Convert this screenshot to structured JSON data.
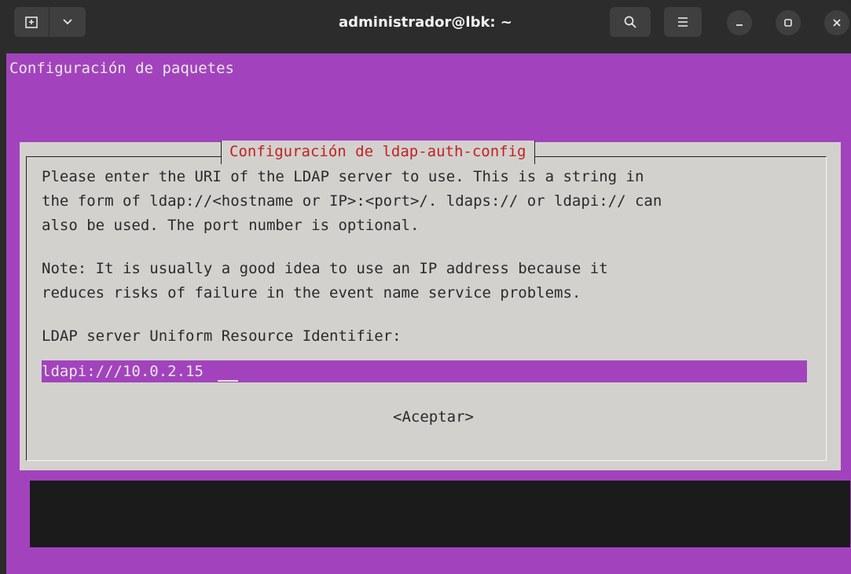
{
  "titlebar": {
    "title": "administrador@lbk: ~",
    "icons": [
      "new-tab-icon",
      "chevron-down-icon",
      "search-icon",
      "hamburger-menu-icon",
      "minimize-icon",
      "maximize-icon",
      "close-icon"
    ]
  },
  "terminal": {
    "header": "Configuración de paquetes"
  },
  "dialog": {
    "title": "Configuración de ldap-auth-config",
    "description": [
      "Please enter the URI of the LDAP server to use. This is a string in",
      "the form of ldap://<hostname or IP>:<port>/. ldaps:// or ldapi:// can",
      "also be used. The port number is optional."
    ],
    "note": [
      "Note: It is usually a good idea to use an IP address because it",
      "reduces risks of failure in the event name service problems."
    ],
    "field_label": "LDAP server Uniform Resource Identifier:",
    "field_value": "ldapi:///10.0.2.15",
    "ok_button": "<Aceptar>"
  },
  "colors": {
    "terminal_bg": "#a243bd",
    "dialog_bg": "#d3d1ce",
    "title_red": "#c02222"
  }
}
